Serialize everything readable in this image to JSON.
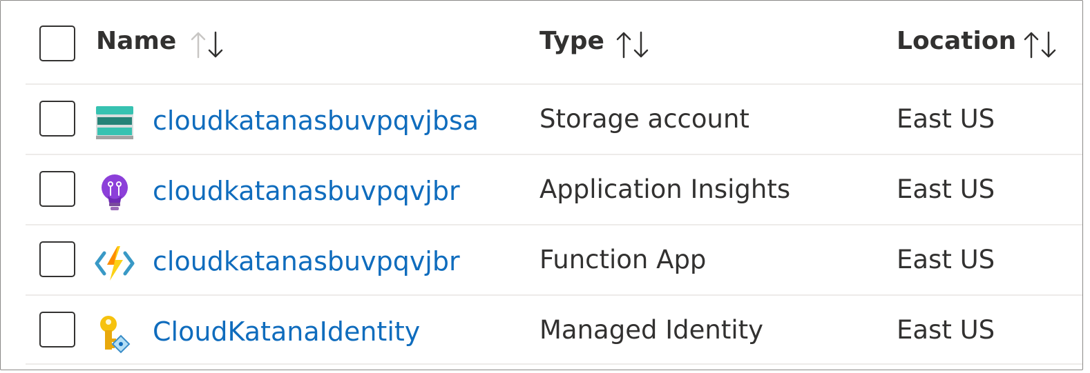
{
  "table": {
    "columns": [
      {
        "label": "Name",
        "sort_icon": "sort-ascending-descending-icon"
      },
      {
        "label": "Type",
        "sort_icon": "sort-ascending-descending-icon"
      },
      {
        "label": "Location",
        "sort_icon": "sort-ascending-descending-icon"
      }
    ],
    "rows": [
      {
        "name": "cloudkatanasbuvpqvjbsa",
        "type": "Storage account",
        "location": "East US",
        "icon": "storage-account-icon"
      },
      {
        "name": "cloudkatanasbuvpqvjbr",
        "type": "Application Insights",
        "location": "East US",
        "icon": "application-insights-icon"
      },
      {
        "name": "cloudkatanasbuvpqvjbr",
        "type": "Function App",
        "location": "East US",
        "icon": "function-app-icon"
      },
      {
        "name": "CloudKatanaIdentity",
        "type": "Managed Identity",
        "location": "East US",
        "icon": "managed-identity-icon"
      }
    ]
  },
  "colors": {
    "link": "#0f6cbd",
    "text": "#323130",
    "divider": "#edebe9"
  }
}
